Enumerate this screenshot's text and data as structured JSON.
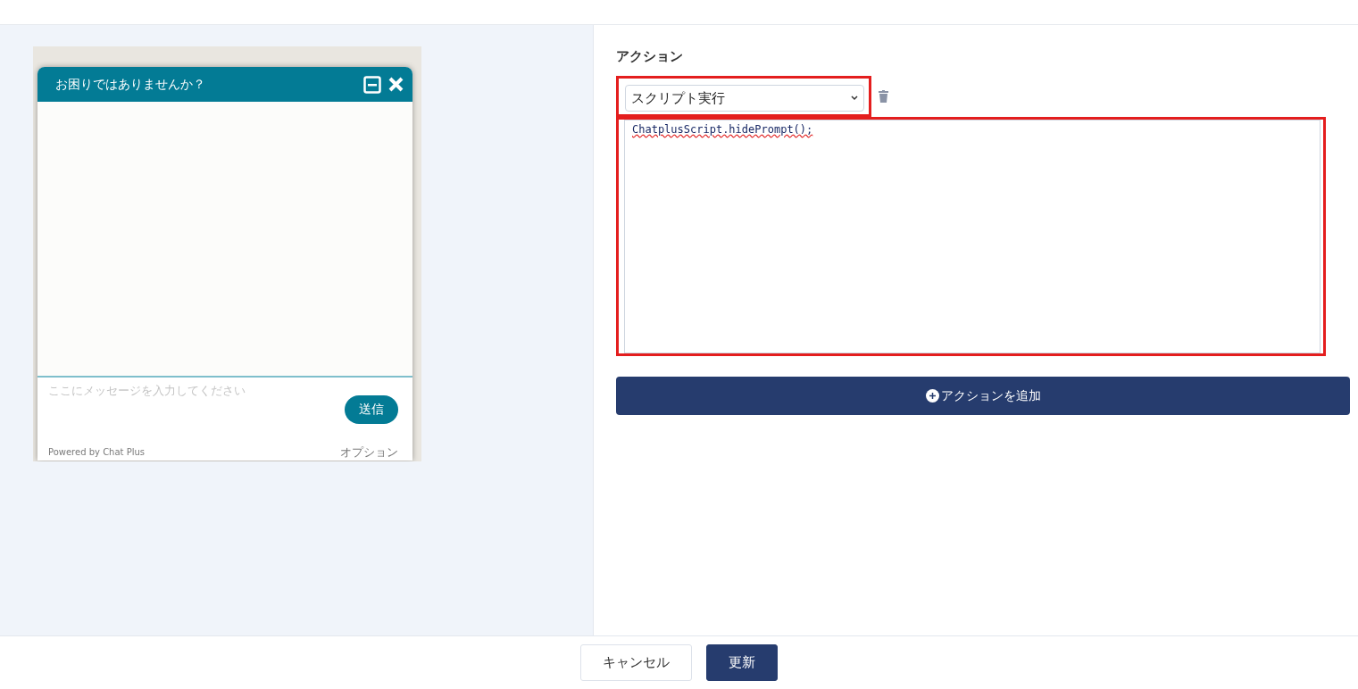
{
  "preview": {
    "title": "お困りではありませんか？",
    "placeholder": "ここにメッセージを入力してください",
    "send": "送信",
    "powered_by": "Powered by Chat Plus",
    "options": "オプション"
  },
  "actions": {
    "heading": "アクション",
    "select_value": "スクリプト実行",
    "script": "ChatplusScript.hidePrompt();",
    "highlighted": true,
    "add_button": "アクションを追加"
  },
  "footer": {
    "buttons": [
      {
        "label": "キャンセル",
        "kind": "secondary"
      },
      {
        "label": "更新",
        "kind": "primary"
      }
    ]
  }
}
